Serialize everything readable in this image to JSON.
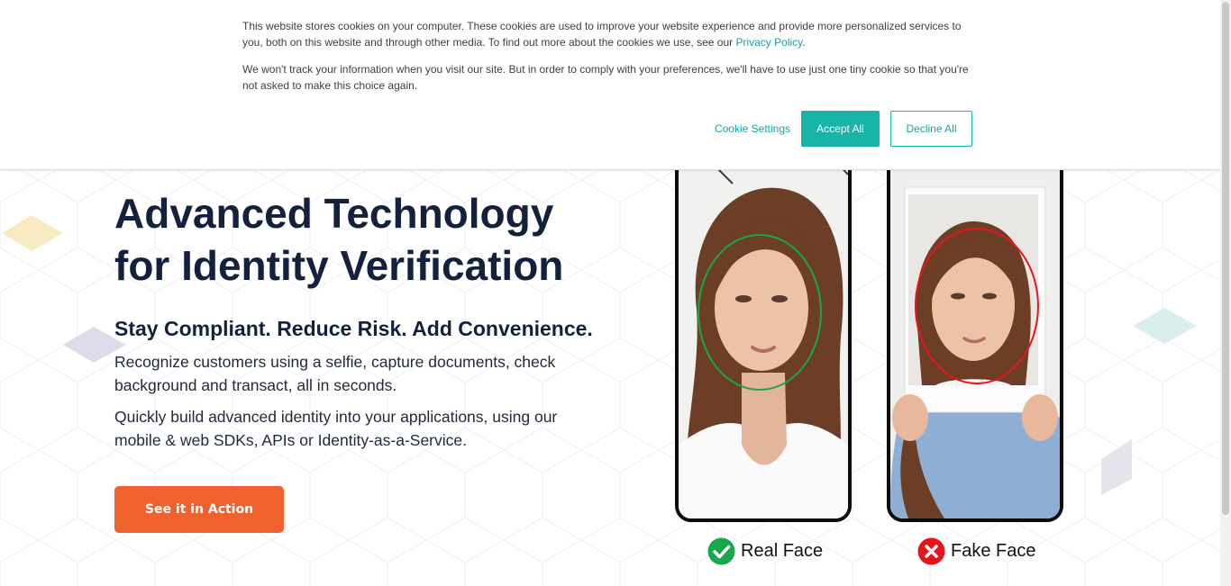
{
  "cookie_banner": {
    "paragraph1_text": "This website stores cookies on your computer. These cookies are used to improve your website experience and provide more personalized services to you, both on this website and through other media. To find out more about the cookies we use, see our",
    "privacy_link": "Privacy Policy",
    "paragraph1_end": ".",
    "paragraph2": "We won't track your information when you visit our site. But in order to comply with your preferences, we'll have to use just one tiny cookie so that you're not asked to make this choice again.",
    "cookie_settings_label": "Cookie Settings",
    "accept_all_label": "Accept All",
    "decline_all_label": "Decline All"
  },
  "hero": {
    "title_line1": "Advanced Technology",
    "title_line2": "for Identity Verification",
    "subtitle": "Stay Compliant. Reduce Risk. Add Convenience.",
    "paragraph1": "Recognize customers using a selfie, capture documents, check background and transact, all in seconds.",
    "paragraph2": "Quickly build advanced identity into your applications, using our mobile & web SDKs, APIs or Identity-as-a-Service.",
    "cta_label": "See it in Action"
  },
  "demo": {
    "real_label": "Real Face",
    "fake_label": "Fake Face",
    "real_icon": "check-circle-icon",
    "fake_icon": "x-circle-icon"
  },
  "colors": {
    "accent_teal": "#16b5a8",
    "cta_orange": "#ef622d",
    "heading_navy": "#14213d",
    "real_green": "#1aa64a",
    "fake_red": "#e5151b"
  }
}
